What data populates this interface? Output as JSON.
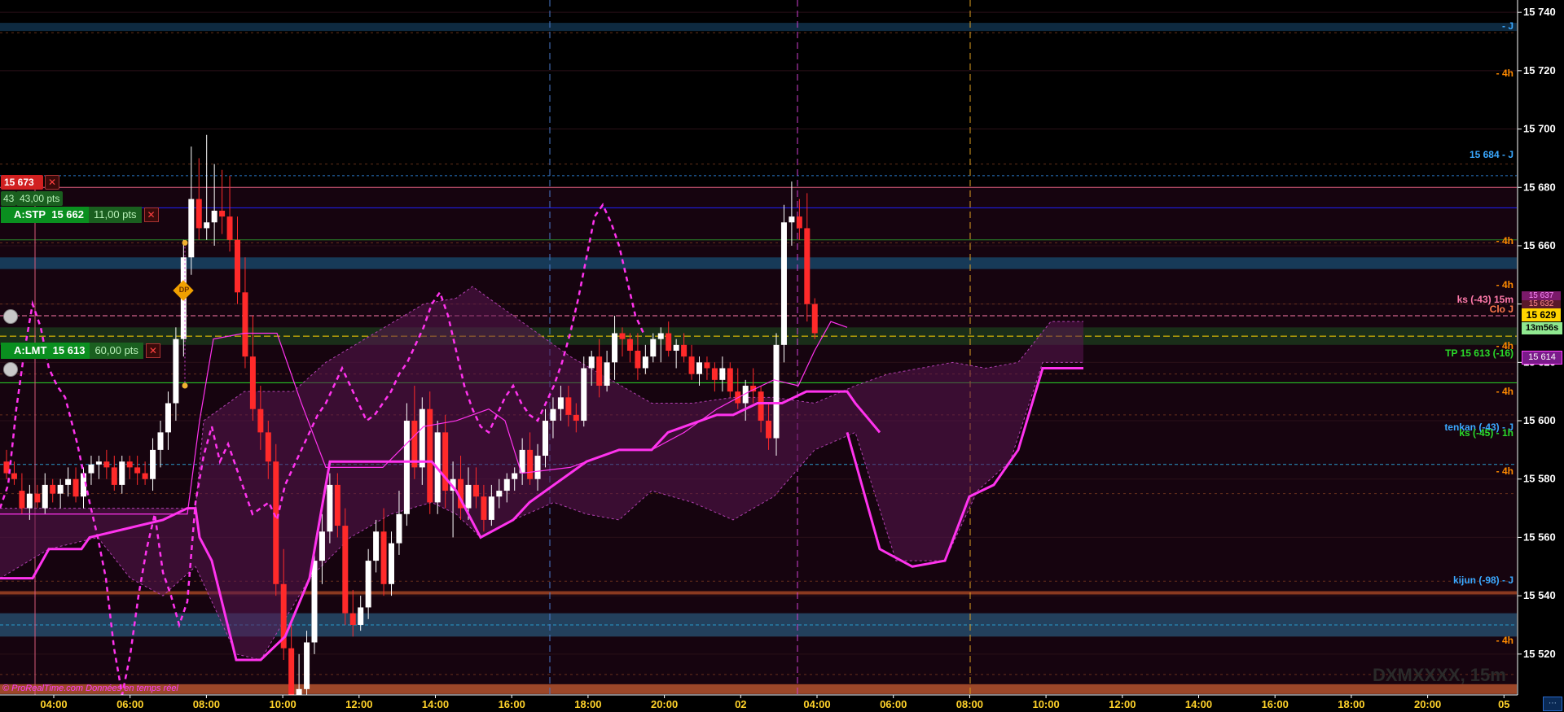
{
  "chart_data": {
    "type": "candlestick",
    "instrument_watermark": "DXMXXXX, 15m",
    "source_note": "© ProRealTime.com  Données en temps réel",
    "y_ticks": [
      "15 740",
      "15 720",
      "15 700",
      "15 680",
      "15 660",
      "15 640",
      "15 620",
      "15 600",
      "15 580",
      "15 560",
      "15 540",
      "15 520"
    ],
    "y_tick_values": [
      15740,
      15720,
      15700,
      15680,
      15660,
      15640,
      15620,
      15600,
      15580,
      15560,
      15540,
      15520
    ],
    "x_ticks": [
      "04:00",
      "06:00",
      "08:00",
      "10:00",
      "12:00",
      "14:00",
      "16:00",
      "18:00",
      "20:00",
      "02",
      "04:00",
      "06:00",
      "08:00",
      "10:00",
      "12:00",
      "14:00",
      "16:00",
      "18:00",
      "20:00",
      "05"
    ],
    "y_range": [
      15506,
      15742
    ],
    "current_price": "15 629",
    "countdown": "13m56s",
    "right_badges": {
      "ks_value": "15 637",
      "ks_value2": "15 632",
      "tp_value": "15 614"
    },
    "level_labels": {
      "day_top": "- J",
      "h4": "- 4h",
      "resistance": "15 684 - J",
      "ks_15m": "ks (-43) 15m",
      "clo": "Clo J",
      "tp": "TP 15 613 (-16)",
      "tenkan": "tenkan (-43) - J",
      "ks1h": "ks (-45) - 1h",
      "kijun": "kijun (-98) - J"
    },
    "orders": {
      "position_price": "15 673",
      "position_qty": "43",
      "position_pts": "43,00 pts",
      "stop_label": "A:STP",
      "stop_price": "15 662",
      "stop_pts": "11,00 pts",
      "limit_label": "A:LMT",
      "limit_price": "15 613",
      "limit_pts": "60,00 pts",
      "dp_badge": "DP"
    },
    "colors": {
      "up": "#ffffff",
      "down": "#ff2a2a",
      "magenta": "#ff33ee",
      "cloud": "#5a1650",
      "axis_text": "#ffffff",
      "time_text": "#ffd22a",
      "h4_text": "#ff8a00",
      "blue_label": "#3aa8ff",
      "green_label": "#2adb2a",
      "price_badge": "#ffd400"
    },
    "candles": [
      [
        15586,
        15590,
        15580,
        15582
      ],
      [
        15582,
        15586,
        15578,
        15580
      ],
      [
        15576,
        15582,
        15568,
        15570
      ],
      [
        15570,
        15578,
        15566,
        15575
      ],
      [
        15575,
        15578,
        15570,
        15572
      ],
      [
        15570,
        15582,
        15568,
        15578
      ],
      [
        15578,
        15580,
        15572,
        15575
      ],
      [
        15575,
        15580,
        15570,
        15578
      ],
      [
        15578,
        15584,
        15574,
        15580
      ],
      [
        15580,
        15584,
        15572,
        15574
      ],
      [
        15574,
        15584,
        15570,
        15582
      ],
      [
        15582,
        15588,
        15578,
        15585
      ],
      [
        15585,
        15588,
        15580,
        15586
      ],
      [
        15586,
        15590,
        15580,
        15584
      ],
      [
        15584,
        15588,
        15576,
        15578
      ],
      [
        15578,
        15588,
        15575,
        15586
      ],
      [
        15586,
        15588,
        15580,
        15584
      ],
      [
        15584,
        15588,
        15578,
        15582
      ],
      [
        15582,
        15586,
        15578,
        15580
      ],
      [
        15580,
        15594,
        15576,
        15590
      ],
      [
        15590,
        15600,
        15584,
        15596
      ],
      [
        15596,
        15610,
        15590,
        15606
      ],
      [
        15606,
        15632,
        15600,
        15628
      ],
      [
        15628,
        15662,
        15622,
        15656
      ],
      [
        15656,
        15694,
        15650,
        15676
      ],
      [
        15676,
        15690,
        15662,
        15666
      ],
      [
        15666,
        15698,
        15662,
        15668
      ],
      [
        15668,
        15688,
        15660,
        15672
      ],
      [
        15672,
        15686,
        15664,
        15670
      ],
      [
        15670,
        15684,
        15658,
        15662
      ],
      [
        15662,
        15670,
        15640,
        15644
      ],
      [
        15644,
        15656,
        15618,
        15622
      ],
      [
        15622,
        15636,
        15600,
        15604
      ],
      [
        15604,
        15612,
        15590,
        15596
      ],
      [
        15596,
        15600,
        15580,
        15586
      ],
      [
        15586,
        15592,
        15540,
        15544
      ],
      [
        15544,
        15556,
        15518,
        15522
      ],
      [
        15522,
        15530,
        15500,
        15504
      ],
      [
        15504,
        15520,
        15498,
        15508
      ],
      [
        15508,
        15528,
        15504,
        15524
      ],
      [
        15524,
        15556,
        15520,
        15552
      ],
      [
        15552,
        15568,
        15544,
        15562
      ],
      [
        15562,
        15582,
        15558,
        15578
      ],
      [
        15578,
        15582,
        15560,
        15564
      ],
      [
        15564,
        15570,
        15530,
        15534
      ],
      [
        15534,
        15542,
        15526,
        15530
      ],
      [
        15530,
        15540,
        15528,
        15536
      ],
      [
        15536,
        15556,
        15532,
        15552
      ],
      [
        15552,
        15566,
        15548,
        15562
      ],
      [
        15562,
        15570,
        15540,
        15544
      ],
      [
        15544,
        15562,
        15540,
        15558
      ],
      [
        15558,
        15576,
        15554,
        15568
      ],
      [
        15568,
        15606,
        15564,
        15600
      ],
      [
        15600,
        15612,
        15580,
        15584
      ],
      [
        15584,
        15608,
        15578,
        15604
      ],
      [
        15604,
        15610,
        15568,
        15572
      ],
      [
        15572,
        15600,
        15568,
        15596
      ],
      [
        15596,
        15602,
        15570,
        15576
      ],
      [
        15576,
        15586,
        15560,
        15580
      ],
      [
        15580,
        15588,
        15566,
        15570
      ],
      [
        15570,
        15584,
        15566,
        15578
      ],
      [
        15578,
        15584,
        15570,
        15574
      ],
      [
        15574,
        15578,
        15562,
        15566
      ],
      [
        15566,
        15578,
        15564,
        15574
      ],
      [
        15574,
        15580,
        15570,
        15576
      ],
      [
        15576,
        15582,
        15572,
        15580
      ],
      [
        15580,
        15584,
        15576,
        15582
      ],
      [
        15582,
        15594,
        15578,
        15590
      ],
      [
        15590,
        15596,
        15578,
        15580
      ],
      [
        15580,
        15592,
        15576,
        15588
      ],
      [
        15588,
        15604,
        15584,
        15600
      ],
      [
        15600,
        15608,
        15594,
        15604
      ],
      [
        15604,
        15612,
        15600,
        15608
      ],
      [
        15608,
        15612,
        15598,
        15602
      ],
      [
        15602,
        15606,
        15596,
        15600
      ],
      [
        15600,
        15622,
        15598,
        15618
      ],
      [
        15618,
        15624,
        15612,
        15622
      ],
      [
        15622,
        15628,
        15608,
        15612
      ],
      [
        15612,
        15624,
        15610,
        15620
      ],
      [
        15620,
        15636,
        15614,
        15630
      ],
      [
        15630,
        15632,
        15622,
        15628
      ],
      [
        15628,
        15630,
        15620,
        15624
      ],
      [
        15624,
        15630,
        15614,
        15618
      ],
      [
        15618,
        15626,
        15616,
        15622
      ],
      [
        15622,
        15630,
        15620,
        15628
      ],
      [
        15628,
        15632,
        15620,
        15630
      ],
      [
        15630,
        15634,
        15622,
        15624
      ],
      [
        15624,
        15628,
        15618,
        15626
      ],
      [
        15626,
        15630,
        15620,
        15622
      ],
      [
        15622,
        15626,
        15614,
        15616
      ],
      [
        15616,
        15622,
        15612,
        15620
      ],
      [
        15620,
        15622,
        15614,
        15618
      ],
      [
        15618,
        15620,
        15610,
        15614
      ],
      [
        15614,
        15622,
        15610,
        15618
      ],
      [
        15618,
        15620,
        15608,
        15610
      ],
      [
        15610,
        15618,
        15604,
        15606
      ],
      [
        15606,
        15614,
        15600,
        15612
      ],
      [
        15612,
        15618,
        15606,
        15610
      ],
      [
        15610,
        15612,
        15596,
        15600
      ],
      [
        15600,
        15606,
        15590,
        15594
      ],
      [
        15594,
        15630,
        15588,
        15626
      ],
      [
        15626,
        15674,
        15620,
        15668
      ],
      [
        15668,
        15682,
        15660,
        15670
      ],
      [
        15670,
        15676,
        15662,
        15666
      ],
      [
        15666,
        15678,
        15634,
        15640
      ],
      [
        15640,
        15642,
        15628,
        15630
      ]
    ],
    "kijun_line": [
      [
        0,
        15546
      ],
      [
        40,
        15546
      ],
      [
        60,
        15556
      ],
      [
        100,
        15556
      ],
      [
        110,
        15560
      ],
      [
        140,
        15562
      ],
      [
        200,
        15566
      ],
      [
        230,
        15570
      ],
      [
        240,
        15570
      ],
      [
        245,
        15560
      ],
      [
        260,
        15552
      ],
      [
        290,
        15518
      ],
      [
        320,
        15518
      ],
      [
        350,
        15526
      ],
      [
        380,
        15546
      ],
      [
        405,
        15586
      ],
      [
        530,
        15586
      ],
      [
        560,
        15576
      ],
      [
        590,
        15560
      ],
      [
        630,
        15566
      ],
      [
        650,
        15572
      ],
      [
        680,
        15578
      ],
      [
        720,
        15586
      ],
      [
        760,
        15590
      ],
      [
        800,
        15590
      ],
      [
        820,
        15596
      ],
      [
        840,
        15598
      ],
      [
        860,
        15600
      ],
      [
        880,
        15602
      ],
      [
        900,
        15602
      ],
      [
        930,
        15606
      ],
      [
        960,
        15606
      ],
      [
        990,
        15610
      ],
      [
        1040,
        15610
      ],
      [
        1050,
        15606
      ],
      [
        1080,
        15596
      ]
    ],
    "tenkan_line": [
      [
        0,
        15568
      ],
      [
        230,
        15568
      ],
      [
        245,
        15600
      ],
      [
        262,
        15628
      ],
      [
        300,
        15630
      ],
      [
        340,
        15630
      ],
      [
        370,
        15606
      ],
      [
        400,
        15584
      ],
      [
        470,
        15584
      ],
      [
        520,
        15598
      ],
      [
        560,
        15600
      ],
      [
        600,
        15604
      ],
      [
        620,
        15600
      ],
      [
        640,
        15582
      ],
      [
        700,
        15584
      ],
      [
        720,
        15586
      ],
      [
        760,
        15590
      ],
      [
        800,
        15590
      ],
      [
        840,
        15596
      ],
      [
        880,
        15604
      ],
      [
        920,
        15610
      ],
      [
        950,
        15614
      ],
      [
        980,
        15612
      ],
      [
        1000,
        15624
      ],
      [
        1020,
        15634
      ],
      [
        1040,
        15632
      ]
    ],
    "chikou_line": [
      [
        0,
        15570
      ],
      [
        10,
        15578
      ],
      [
        20,
        15604
      ],
      [
        30,
        15624
      ],
      [
        40,
        15640
      ],
      [
        50,
        15632
      ],
      [
        60,
        15618
      ],
      [
        70,
        15612
      ],
      [
        80,
        15608
      ],
      [
        95,
        15592
      ],
      [
        110,
        15572
      ],
      [
        120,
        15560
      ],
      [
        130,
        15546
      ],
      [
        140,
        15522
      ],
      [
        150,
        15506
      ],
      [
        160,
        15520
      ],
      [
        170,
        15540
      ],
      [
        180,
        15556
      ],
      [
        190,
        15568
      ],
      [
        200,
        15548
      ],
      [
        210,
        15540
      ],
      [
        220,
        15530
      ],
      [
        230,
        15538
      ],
      [
        240,
        15572
      ],
      [
        250,
        15588
      ],
      [
        260,
        15598
      ],
      [
        270,
        15586
      ],
      [
        280,
        15592
      ],
      [
        290,
        15584
      ],
      [
        300,
        15576
      ],
      [
        310,
        15568
      ],
      [
        320,
        15570
      ],
      [
        330,
        15572
      ],
      [
        340,
        15566
      ],
      [
        350,
        15578
      ],
      [
        360,
        15584
      ],
      [
        370,
        15590
      ],
      [
        380,
        15596
      ],
      [
        390,
        15602
      ],
      [
        400,
        15606
      ],
      [
        410,
        15612
      ],
      [
        420,
        15618
      ],
      [
        430,
        15612
      ],
      [
        440,
        15606
      ],
      [
        450,
        15600
      ],
      [
        460,
        15602
      ],
      [
        470,
        15606
      ],
      [
        480,
        15610
      ],
      [
        490,
        15616
      ],
      [
        500,
        15620
      ],
      [
        510,
        15626
      ],
      [
        520,
        15632
      ],
      [
        530,
        15640
      ],
      [
        540,
        15644
      ],
      [
        550,
        15636
      ],
      [
        560,
        15624
      ],
      [
        570,
        15612
      ],
      [
        580,
        15604
      ],
      [
        590,
        15598
      ],
      [
        600,
        15596
      ],
      [
        610,
        15602
      ],
      [
        620,
        15608
      ],
      [
        630,
        15612
      ],
      [
        640,
        15606
      ],
      [
        650,
        15602
      ],
      [
        660,
        15600
      ],
      [
        670,
        15606
      ],
      [
        680,
        15612
      ],
      [
        690,
        15620
      ],
      [
        700,
        15630
      ],
      [
        710,
        15642
      ],
      [
        720,
        15656
      ],
      [
        730,
        15670
      ],
      [
        740,
        15674
      ],
      [
        750,
        15668
      ],
      [
        760,
        15660
      ],
      [
        770,
        15648
      ],
      [
        780,
        15636
      ],
      [
        790,
        15630
      ]
    ],
    "cloud_top": [
      [
        0,
        15570
      ],
      [
        240,
        15570
      ],
      [
        250,
        15600
      ],
      [
        300,
        15610
      ],
      [
        360,
        15610
      ],
      [
        400,
        15620
      ],
      [
        460,
        15630
      ],
      [
        520,
        15640
      ],
      [
        560,
        15642
      ],
      [
        580,
        15646
      ],
      [
        610,
        15640
      ],
      [
        650,
        15632
      ],
      [
        700,
        15622
      ],
      [
        750,
        15614
      ],
      [
        800,
        15606
      ],
      [
        850,
        15606
      ],
      [
        900,
        15608
      ],
      [
        950,
        15608
      ],
      [
        1000,
        15606
      ],
      [
        1050,
        15612
      ],
      [
        1090,
        15616
      ],
      [
        1130,
        15618
      ],
      [
        1170,
        15620
      ],
      [
        1210,
        15618
      ],
      [
        1250,
        15620
      ],
      [
        1290,
        15634
      ],
      [
        1330,
        15634
      ]
    ],
    "cloud_bottom": [
      [
        0,
        15546
      ],
      [
        60,
        15556
      ],
      [
        120,
        15560
      ],
      [
        160,
        15546
      ],
      [
        200,
        15540
      ],
      [
        240,
        15550
      ],
      [
        290,
        15520
      ],
      [
        320,
        15518
      ],
      [
        380,
        15546
      ],
      [
        430,
        15560
      ],
      [
        480,
        15568
      ],
      [
        530,
        15572
      ],
      [
        560,
        15568
      ],
      [
        590,
        15560
      ],
      [
        630,
        15566
      ],
      [
        680,
        15572
      ],
      [
        720,
        15568
      ],
      [
        760,
        15566
      ],
      [
        800,
        15576
      ],
      [
        850,
        15572
      ],
      [
        900,
        15566
      ],
      [
        950,
        15574
      ],
      [
        1000,
        15590
      ],
      [
        1050,
        15596
      ],
      [
        1100,
        15552
      ],
      [
        1160,
        15552
      ],
      [
        1200,
        15576
      ],
      [
        1240,
        15586
      ],
      [
        1280,
        15620
      ],
      [
        1330,
        15620
      ]
    ],
    "cloud_green_line": [
      [
        1040,
        15596
      ],
      [
        1080,
        15556
      ],
      [
        1120,
        15550
      ],
      [
        1160,
        15552
      ],
      [
        1190,
        15574
      ],
      [
        1220,
        15578
      ],
      [
        1250,
        15590
      ],
      [
        1280,
        15618
      ],
      [
        1330,
        15618
      ]
    ],
    "horizontal_levels": {
      "resistance_top": 15735,
      "day_blue_zone": [
        15652,
        15656
      ],
      "ks_line": 15636,
      "current": 15629,
      "tp": 15613,
      "tenkan_j": 15585,
      "kijun_zone": [
        15526,
        15534
      ],
      "orange_bottom": 15541,
      "orange_bottom2": 15508,
      "blue_high": 15673,
      "green_line": 15662
    }
  }
}
